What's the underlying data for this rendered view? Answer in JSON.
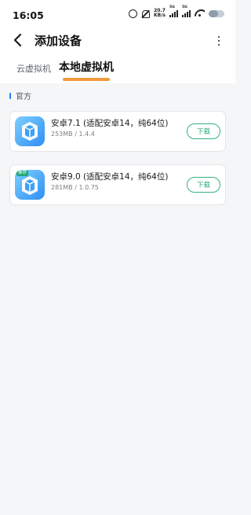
{
  "status_bar": {
    "time": "16:05",
    "network_speed_value": "20.7",
    "network_speed_unit": "KB/s",
    "signal_1_label": "5G",
    "signal_2_label": "5G",
    "icons": [
      "alarm-icon",
      "bell-off-icon",
      "signal-icon",
      "signal-icon",
      "wifi-icon",
      "battery-icon"
    ]
  },
  "header": {
    "back_icon": "chevron-left-icon",
    "title": "添加设备",
    "more_icon": "more-vertical-icon"
  },
  "tabs": [
    {
      "label": "云虚拟机",
      "active": false
    },
    {
      "label": "本地虚拟机",
      "active": true
    }
  ],
  "section": {
    "label": "官方"
  },
  "items": [
    {
      "title": "安卓7.1 (适配安卓14，纯64位)",
      "subtitle": "253MB / 1.4.4",
      "badge": "",
      "button": "下载"
    },
    {
      "title": "安卓9.0 (适配安卓14，纯64位)",
      "subtitle": "281MB / 1.0.75",
      "badge": "推荐",
      "button": "下载"
    }
  ],
  "colors": {
    "accent_tab_indicator": "#f29a3b",
    "section_marker": "#2f7cf6",
    "download_green": "#34b27b",
    "icon_gradient_start": "#7fd0ff",
    "icon_gradient_end": "#2e8ef5",
    "background": "#f5f6f8"
  }
}
